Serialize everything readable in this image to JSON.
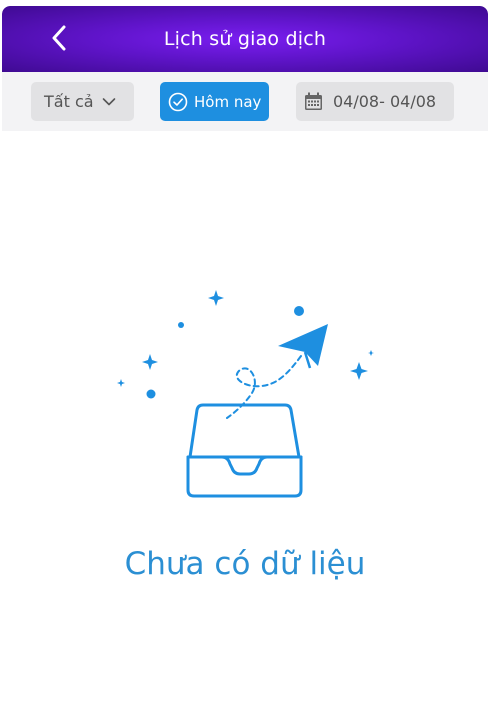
{
  "header": {
    "title": "Lịch sử giao dịch",
    "back_icon": "chevron-left-icon"
  },
  "filters": {
    "all_label": "Tất cả",
    "today_label": "Hôm nay",
    "date_range": "04/08- 04/08"
  },
  "empty_state": {
    "message": "Chưa có dữ liệu",
    "illustration": "empty-tray-paper-plane"
  },
  "colors": {
    "header_gradient": [
      "#7a1ef0",
      "#3f0a92"
    ],
    "accent_blue": "#1e8fe0",
    "empty_text": "#2b8fd3"
  }
}
